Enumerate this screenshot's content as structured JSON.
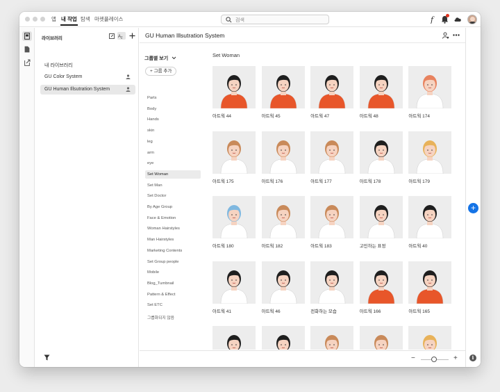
{
  "topnav": {
    "tabs": [
      {
        "label": "앱"
      },
      {
        "label": "내 작업"
      },
      {
        "label": "탐색"
      },
      {
        "label": "마켓플레이스"
      }
    ],
    "search_placeholder": "검색"
  },
  "library_panel": {
    "title": "라이브러리",
    "items": [
      {
        "label": "내 라이브러리"
      },
      {
        "label": "GU Color System"
      },
      {
        "label": "GU Human Illsutration System"
      }
    ]
  },
  "main": {
    "title": "GU Human Illsutration System",
    "group_view_label": "그룹별 보기",
    "add_group_label": "그룹 추가",
    "groups": [
      {
        "label": "Parts"
      },
      {
        "label": "Body"
      },
      {
        "label": "Hands"
      },
      {
        "label": "skin"
      },
      {
        "label": "leg"
      },
      {
        "label": "arm"
      },
      {
        "label": "eye"
      },
      {
        "label": "Set Woman"
      },
      {
        "label": "Set Man"
      },
      {
        "label": "Set Doctor"
      },
      {
        "label": "By Age Group"
      },
      {
        "label": "Face & Emotion"
      },
      {
        "label": "Woman Hairstyles"
      },
      {
        "label": "Man Hairstyles"
      },
      {
        "label": "Marketing Contents"
      },
      {
        "label": "Set Group people"
      },
      {
        "label": "Mobile"
      },
      {
        "label": "Blog_Tumbnail"
      },
      {
        "label": "Pattern & Effect"
      },
      {
        "label": "Set ETC"
      },
      {
        "label": "그룹화되지 않음"
      }
    ],
    "section_title": "Set Woman",
    "assets": [
      {
        "label": "아트웍 44",
        "hair": "#1f1f1f",
        "top": "#e8562a",
        "skin": "#f6d3c1"
      },
      {
        "label": "아트웍 45",
        "hair": "#1f1f1f",
        "top": "#e8562a",
        "skin": "#f6d3c1"
      },
      {
        "label": "아트웍 47",
        "hair": "#1f1f1f",
        "top": "#e8562a",
        "skin": "#f6d3c1"
      },
      {
        "label": "아트웍 48",
        "hair": "#1f1f1f",
        "top": "#e8562a",
        "skin": "#f6d3c1"
      },
      {
        "label": "아트웍 174",
        "hair": "#e8835f",
        "top": "#ffffff",
        "skin": "#f6d3c1"
      },
      {
        "label": "아트웍 175",
        "hair": "#c98a5a",
        "top": "#ffffff",
        "skin": "#f6d3c1"
      },
      {
        "label": "아트웍 176",
        "hair": "#c98a5a",
        "top": "#ffffff",
        "skin": "#f6d3c1"
      },
      {
        "label": "아트웍 177",
        "hair": "#c98a5a",
        "top": "#ffffff",
        "skin": "#f6d3c1"
      },
      {
        "label": "아트웍 178",
        "hair": "#1f1f1f",
        "top": "#ffffff",
        "skin": "#f6d3c1"
      },
      {
        "label": "아트웍 179",
        "hair": "#e8b25a",
        "top": "#ffffff",
        "skin": "#f6d3c1"
      },
      {
        "label": "아트웍 180",
        "hair": "#7fb8e0",
        "top": "#ffffff",
        "skin": "#f6d3c1"
      },
      {
        "label": "아트웍 182",
        "hair": "#c98a5a",
        "top": "#ffffff",
        "skin": "#f6d3c1"
      },
      {
        "label": "아트웍 183",
        "hair": "#c98a5a",
        "top": "#ffffff",
        "skin": "#f6d3c1"
      },
      {
        "label": "고민하는 표정",
        "hair": "#1f1f1f",
        "top": "#ffffff",
        "skin": "#f6d3c1"
      },
      {
        "label": "아트웍 40",
        "hair": "#1f1f1f",
        "top": "#ffffff",
        "skin": "#f6d3c1"
      },
      {
        "label": "아트웍 41",
        "hair": "#1f1f1f",
        "top": "#ffffff",
        "skin": "#f6d3c1"
      },
      {
        "label": "아트웍 46",
        "hair": "#1f1f1f",
        "top": "#ffffff",
        "skin": "#f6d3c1"
      },
      {
        "label": "전화하는 모습",
        "hair": "#1f1f1f",
        "top": "#ffffff",
        "skin": "#f6d3c1"
      },
      {
        "label": "아트웍 166",
        "hair": "#1f1f1f",
        "top": "#e8562a",
        "skin": "#f6d3c1"
      },
      {
        "label": "아트웍 165",
        "hair": "#1f1f1f",
        "top": "#e8562a",
        "skin": "#f6d3c1"
      },
      {
        "label": "",
        "hair": "#1f1f1f",
        "top": "#e8562a",
        "skin": "#f6d3c1"
      },
      {
        "label": "",
        "hair": "#1f1f1f",
        "top": "#e8562a",
        "skin": "#f6d3c1"
      },
      {
        "label": "",
        "hair": "#c98a5a",
        "top": "#ffffff",
        "skin": "#f6d3c1"
      },
      {
        "label": "",
        "hair": "#c98a5a",
        "top": "#e8562a",
        "skin": "#f6d3c1"
      },
      {
        "label": "",
        "hair": "#e8b25a",
        "top": "#ffffff",
        "skin": "#f6d3c1"
      }
    ]
  },
  "colors": {
    "accent": "#1473e6",
    "brand_orange": "#e8562a",
    "notification": "#e0341f"
  }
}
